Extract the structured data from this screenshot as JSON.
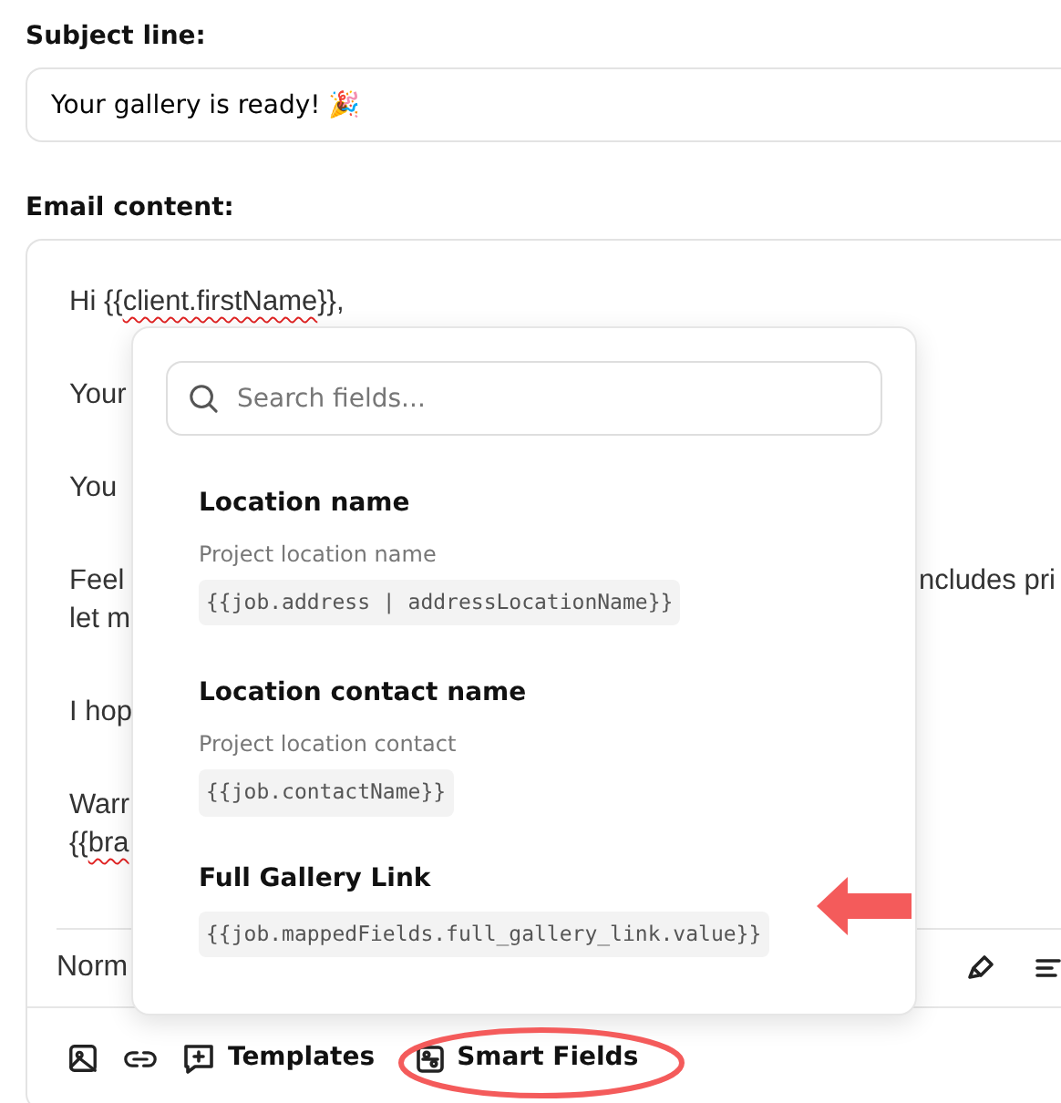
{
  "subject": {
    "label": "Subject line:",
    "value": "Your gallery is ready! 🎉"
  },
  "email": {
    "label": "Email content:",
    "paragraphs": [
      {
        "lines": [
          {
            "left": [
              {
                "text": "Hi {{"
              },
              {
                "text": "client.firstName",
                "misspelled": true
              },
              {
                "text": "}},"
              }
            ]
          }
        ]
      },
      {
        "lines": [
          {
            "left": [
              {
                "text": "Your"
              }
            ]
          }
        ]
      },
      {
        "lines": [
          {
            "left": [
              {
                "text": "You"
              }
            ]
          }
        ]
      },
      {
        "lines": [
          {
            "left": [
              {
                "text": "Feel"
              }
            ],
            "right": "ncludes pri"
          },
          {
            "left": [
              {
                "text": "let m"
              }
            ]
          }
        ]
      },
      {
        "lines": [
          {
            "left": [
              {
                "text": "I hop"
              }
            ]
          }
        ]
      },
      {
        "lines": [
          {
            "left": [
              {
                "text": "Warr"
              }
            ]
          },
          {
            "left": [
              {
                "text": "{{"
              },
              {
                "text": "bra",
                "misspelled": true
              }
            ]
          }
        ]
      }
    ],
    "format_label": "Norm",
    "bottom_buttons": [
      {
        "kind": "image"
      },
      {
        "kind": "link"
      },
      {
        "kind": "templates",
        "label": "Templates"
      },
      {
        "kind": "smart",
        "label": "Smart Fields"
      }
    ]
  },
  "popup": {
    "search": {
      "placeholder": "Search fields..."
    },
    "fields": [
      {
        "title": "Location name",
        "description": "Project location name",
        "code": "{{job.address | addressLocationName}}"
      },
      {
        "title": "Location contact name",
        "description": "Project location contact",
        "code": "{{job.contactName}}"
      },
      {
        "title": "Full Gallery Link",
        "code": "{{job.mappedFields.full_gallery_link.value}}"
      }
    ]
  },
  "pointer_arrow": {
    "color": "#f45b5b"
  },
  "highlight_ellipse": {
    "color": "#f45b5b"
  }
}
